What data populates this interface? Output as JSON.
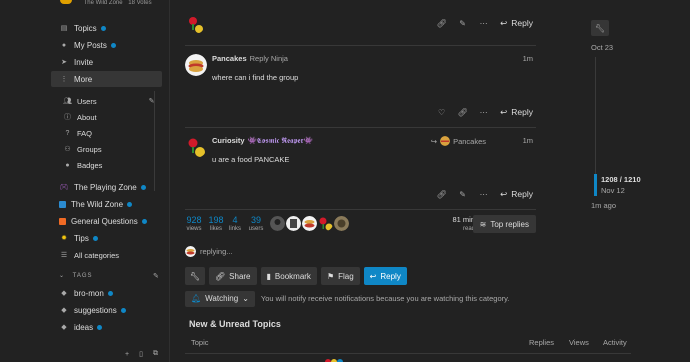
{
  "top_strip": {
    "category": "The Wild Zone",
    "votes": "18 Votes"
  },
  "sidebar": {
    "items": [
      {
        "label": "Topics",
        "icon": "topics-icon",
        "dot": true
      },
      {
        "label": "My Posts",
        "icon": "user-icon",
        "dot": true
      },
      {
        "label": "Invite",
        "icon": "paper-plane-icon",
        "dot": false
      },
      {
        "label": "More",
        "icon": "more-vertical-icon",
        "dot": false
      }
    ],
    "more_items": [
      {
        "label": "Users",
        "icon": "users-icon"
      },
      {
        "label": "About",
        "icon": "info-icon"
      },
      {
        "label": "FAQ",
        "icon": "question-icon"
      },
      {
        "label": "Groups",
        "icon": "groups-icon"
      },
      {
        "label": "Badges",
        "icon": "badge-icon"
      }
    ],
    "categories": [
      {
        "label": "The Playing Zone",
        "icon": "gamepad-icon",
        "color": "#9b59b6",
        "dot": true
      },
      {
        "label": "The Wild Zone",
        "icon": "square-icon",
        "color": "#2b8bd0",
        "dot": true
      },
      {
        "label": "General Questions",
        "icon": "square-icon",
        "color": "#f06a24",
        "dot": true
      },
      {
        "label": "Tips",
        "icon": "lightbulb-icon",
        "color": "#f1c40f",
        "dot": true
      },
      {
        "label": "All categories",
        "icon": "list-icon",
        "color": "#a9a9a9",
        "dot": false
      }
    ],
    "tags_title": "TAGS",
    "tags": [
      {
        "label": "bro-mon",
        "dot": true
      },
      {
        "label": "suggestions",
        "dot": true
      },
      {
        "label": "ideas",
        "dot": true
      }
    ]
  },
  "posts": [
    {
      "username": "Pancakes",
      "user_title": "Reply Ninja",
      "time": "1m",
      "body": "where can i find the group",
      "reply_label": "Reply"
    },
    {
      "username": "Curiosity",
      "user_title": "👾𝕮𝖔𝖘𝖒𝖎𝖈 𝕽𝖊𝖆𝖕𝖊𝖗👾",
      "reply_to": "Pancakes",
      "time": "1m",
      "body": "u are a food PANCAKE",
      "reply_label": "Reply"
    }
  ],
  "top_reply_label": "Reply",
  "topic_map": {
    "views": "928",
    "views_label": "views",
    "likes": "198",
    "likes_label": "likes",
    "links": "4",
    "links_label": "links",
    "users": "39",
    "users_label": "users",
    "read_time": "81 min",
    "read_label": "read",
    "top_replies_label": "Top replies"
  },
  "replying_text": "replying...",
  "footer_buttons": {
    "share": "Share",
    "bookmark": "Bookmark",
    "flag": "Flag",
    "reply": "Reply"
  },
  "notification": {
    "level": "Watching",
    "text": "You will notify receive notifications because you are watching this category."
  },
  "new_unread": {
    "title": "New & Unread Topics",
    "columns": [
      "Topic",
      "Replies",
      "Views",
      "Activity"
    ]
  },
  "timeline": {
    "start_date": "Oct 23",
    "position": "1208 / 1210",
    "current_date": "Nov 12",
    "last_activity": "1m ago"
  },
  "colors": {
    "accent": "#0f87c6",
    "background": "#222222",
    "button": "#363636"
  }
}
